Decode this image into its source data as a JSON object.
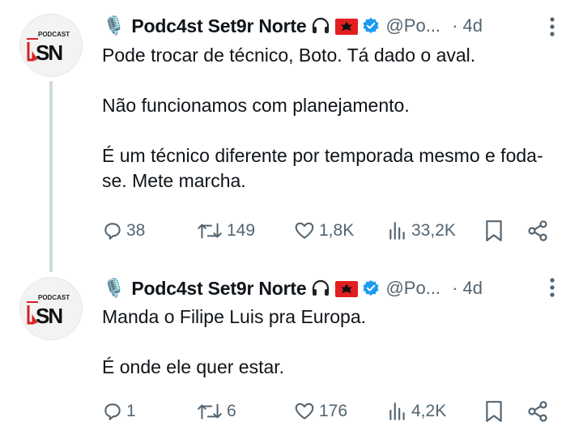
{
  "thread_line_color": "#cfd9de",
  "accent_color": "#1d9bf0",
  "tweets": [
    {
      "emoji": "🎙️",
      "display_name": "Podc4st Set9r Norte",
      "handle": "@Po...",
      "time": "· 4d",
      "avatar": {
        "top_text": "PODCAST",
        "letters": "SN"
      },
      "icons": [
        "microphone-icon",
        "headphones-icon",
        "albania-flag-icon",
        "verified-badge-icon",
        "more-options-icon"
      ],
      "paragraphs": [
        "Pode trocar de técnico, Boto. Tá dado o aval.",
        "Não funcionamos com planejamento.",
        "É um técnico diferente por temporada mesmo e foda-se. Mete marcha."
      ],
      "actions": {
        "replies": "38",
        "retweets": "149",
        "likes": "1,8K",
        "views": "33,2K"
      }
    },
    {
      "emoji": "🎙️",
      "display_name": "Podc4st Set9r Norte",
      "handle": "@Po...",
      "time": "· 4d",
      "avatar": {
        "top_text": "PODCAST",
        "letters": "SN"
      },
      "icons": [
        "microphone-icon",
        "headphones-icon",
        "albania-flag-icon",
        "verified-badge-icon",
        "more-options-icon"
      ],
      "paragraphs": [
        "Manda o Filipe Luis pra Europa.",
        "É onde ele quer estar."
      ],
      "actions": {
        "replies": "1",
        "retweets": "6",
        "likes": "176",
        "views": "4,2K"
      }
    }
  ]
}
